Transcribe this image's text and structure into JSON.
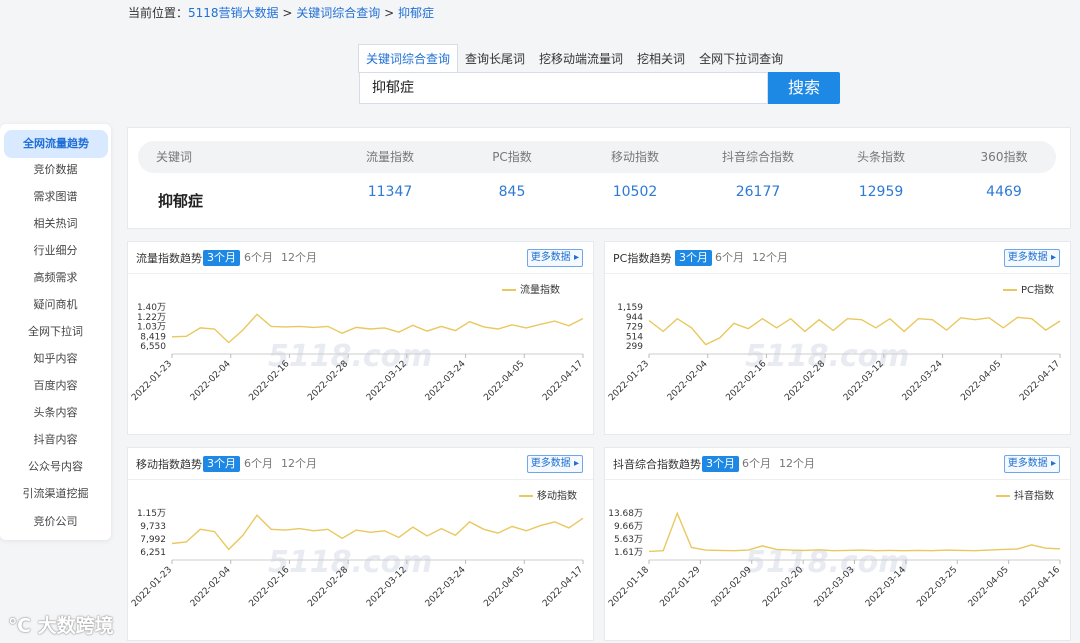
{
  "breadcrumb": {
    "prefix": "当前位置：",
    "items": [
      "5118营销大数据",
      "关键词综合查询",
      "抑郁症"
    ],
    "sep": " > "
  },
  "search": {
    "tabs": [
      "关键词综合查询",
      "查询长尾词",
      "挖移动端流量词",
      "挖相关词",
      "全网下拉词查询"
    ],
    "active_tab": 0,
    "value": "抑郁症",
    "button": "搜索"
  },
  "sidebar": {
    "items": [
      "全网流量趋势",
      "竞价数据",
      "需求图谱",
      "相关热词",
      "行业细分",
      "高频需求",
      "疑问商机",
      "全网下拉词",
      "知乎内容",
      "百度内容",
      "头条内容",
      "抖音内容",
      "公众号内容",
      "引流渠道挖掘",
      "竞价公司"
    ],
    "active": 0
  },
  "keyword_table": {
    "headers": [
      "关键词",
      "流量指数",
      "PC指数",
      "移动指数",
      "抖音综合指数",
      "头条指数",
      "360指数"
    ],
    "keyword": "抑郁症",
    "values": [
      "11347",
      "845",
      "10502",
      "26177",
      "12959",
      "4469"
    ]
  },
  "ranges": [
    "3个月",
    "6个月",
    "12个月"
  ],
  "more_label": "更多数据",
  "watermark": "5118.com",
  "corner_logo": "大数跨境",
  "colors": {
    "accent": "#1e88e5",
    "line": "#e9c85f",
    "link": "#1f6fd6"
  },
  "charts": [
    {
      "title": "流量指数趋势",
      "legend": "流量指数"
    },
    {
      "title": "PC指数趋势",
      "legend": "PC指数"
    },
    {
      "title": "移动指数趋势",
      "legend": "移动指数"
    },
    {
      "title": "抖音综合指数趋势",
      "legend": "抖音指数"
    }
  ],
  "chart_data": [
    {
      "type": "line",
      "title": "流量指数趋势",
      "x": [
        "2022-01-23",
        "2022-02-04",
        "2022-02-16",
        "2022-02-28",
        "2022-03-12",
        "2022-03-24",
        "2022-04-05",
        "2022-04-17"
      ],
      "y_ticks": [
        "1.40万",
        "1.22万",
        "1.03万",
        "8,419",
        "6,550"
      ],
      "ylim": [
        6550,
        14000
      ],
      "series": [
        {
          "name": "流量指数",
          "values": [
            8300,
            8400,
            10000,
            9800,
            7200,
            9600,
            12600,
            10300,
            10200,
            10300,
            10100,
            10300,
            9000,
            10100,
            9800,
            10000,
            9200,
            10500,
            9400,
            10300,
            9500,
            11200,
            10200,
            9800,
            10600,
            10000,
            10700,
            11300,
            10400,
            11800
          ]
        }
      ]
    },
    {
      "type": "line",
      "title": "PC指数趋势",
      "x": [
        "2022-01-23",
        "2022-02-04",
        "2022-02-16",
        "2022-02-28",
        "2022-03-12",
        "2022-03-24",
        "2022-04-05",
        "2022-04-17"
      ],
      "y_ticks": [
        "1,159",
        "944",
        "729",
        "514",
        "299"
      ],
      "ylim": [
        299,
        1159
      ],
      "series": [
        {
          "name": "PC指数",
          "values": [
            860,
            620,
            900,
            700,
            330,
            480,
            800,
            680,
            900,
            700,
            900,
            620,
            880,
            640,
            900,
            880,
            700,
            900,
            620,
            900,
            880,
            650,
            920,
            880,
            920,
            700,
            930,
            900,
            650,
            850
          ]
        }
      ]
    },
    {
      "type": "line",
      "title": "移动指数趋势",
      "x": [
        "2022-01-23",
        "2022-02-04",
        "2022-02-16",
        "2022-02-28",
        "2022-03-12",
        "2022-03-24",
        "2022-04-05",
        "2022-04-17"
      ],
      "y_ticks": [
        "1.15万",
        "9,733",
        "7,992",
        "6,251"
      ],
      "ylim": [
        6251,
        11500
      ],
      "series": [
        {
          "name": "移动指数",
          "values": [
            7400,
            7600,
            9300,
            9000,
            6600,
            8500,
            11200,
            9300,
            9200,
            9400,
            9100,
            9300,
            8100,
            9200,
            8900,
            9100,
            8200,
            9600,
            8400,
            9400,
            8500,
            10300,
            9300,
            8800,
            9700,
            9100,
            9800,
            10300,
            9500,
            10800
          ]
        }
      ]
    },
    {
      "type": "line",
      "title": "抖音综合指数趋势",
      "x": [
        "2022-01-18",
        "2022-01-29",
        "2022-02-09",
        "2022-02-20",
        "2022-03-03",
        "2022-03-14",
        "2022-03-25",
        "2022-04-05",
        "2022-04-16"
      ],
      "y_ticks": [
        "13.68万",
        "9.66万",
        "5.63万",
        "1.61万"
      ],
      "ylim": [
        16100,
        136800
      ],
      "series": [
        {
          "name": "抖音指数",
          "values": [
            18000,
            20000,
            136000,
            30000,
            22000,
            21000,
            20000,
            22000,
            35000,
            24000,
            22000,
            21000,
            23000,
            20000,
            21000,
            22000,
            20000,
            21000,
            20000,
            21000,
            20000,
            22000,
            21000,
            20000,
            22000,
            24000,
            25000,
            38000,
            28000,
            26000
          ]
        }
      ]
    }
  ]
}
